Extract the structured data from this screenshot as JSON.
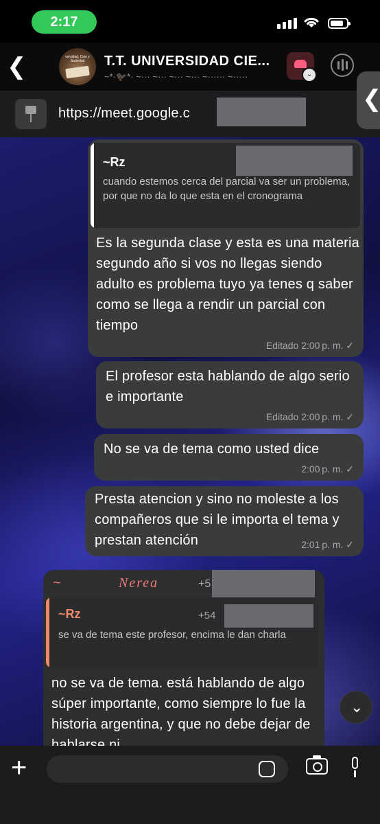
{
  "status_bar": {
    "time": "2:17"
  },
  "header": {
    "back_icon": "chevron-left-icon",
    "title": "T.T. UNIVERSIDAD CIE...",
    "subtitle": "~*·🐦‍⬛*· ~··· ~··· ~··· ~··· ~······ ~·····",
    "avatar_text": "versidad, Cien y Sociedad"
  },
  "pinned": {
    "url": "https://meet.google.c"
  },
  "messages": [
    {
      "quote": {
        "name": "~Rz",
        "text": "cuando estemos cerca del parcial va ser un problema, por que no da lo que esta en el cronograma"
      },
      "text": "Es la segunda clase y esta es una materia segundo año si vos no llegas siendo adulto es problema tuyo ya tenes q saber como se llega a rendir un parcial con tiempo",
      "meta": "Editado 2:00 p. m. ✓"
    },
    {
      "text": "El profesor esta hablando de algo serio e importante",
      "meta": "Editado 2:00 p. m. ✓"
    },
    {
      "text": "No se va de tema como usted dice",
      "meta": "2:00 p. m. ✓"
    },
    {
      "text": "Presta atencion y sino no moleste a los compañeros que si le importa el tema y prestan atención",
      "meta": "2:01 p. m. ✓"
    }
  ],
  "incoming": {
    "sender_prefix": "~",
    "sender_name": "Nerea",
    "sender_phone": "+5",
    "quote": {
      "name": "~Rz",
      "phone": "+54",
      "text": "se va de tema este profesor, encima le dan charla"
    },
    "text": "no se va de tema. está hablando de algo súper importante, como siempre lo fue la historia argentina, y que no debe dejar de hablarse ni"
  },
  "colors": {
    "bubble": "#3a3b3d",
    "quote_bar_outgoing": "#ffffff",
    "quote_bar_incoming": "#f0886a",
    "sender_name": "#f07a7a",
    "time_pill": "#34c759"
  }
}
